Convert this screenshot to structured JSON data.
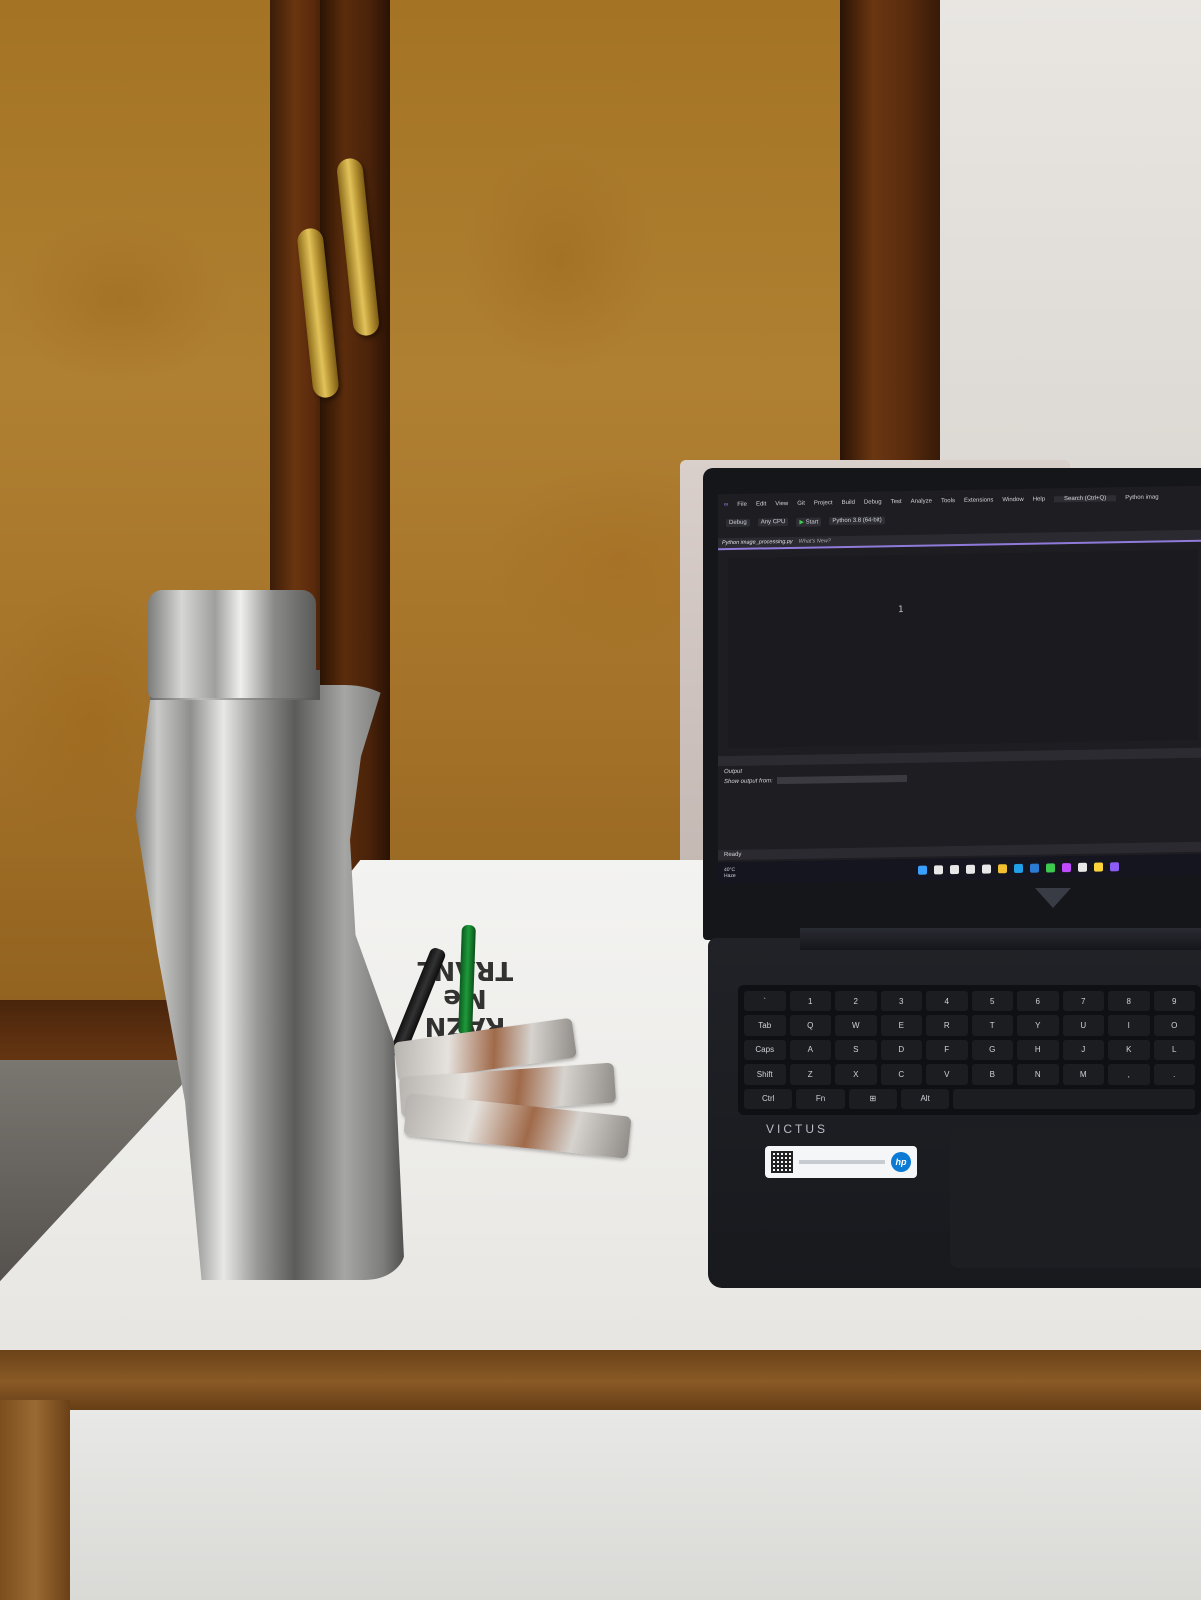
{
  "scene": {
    "objects": [
      "steel-bottle",
      "laptop",
      "green-pen",
      "black-pen",
      "medicine-strips",
      "wardrobe",
      "desk"
    ]
  },
  "marker_writing": {
    "line1": "RAZN",
    "line2": "Me",
    "line3": "TRANL"
  },
  "laptop": {
    "brand": "VICTUS",
    "sticker_logo": "hp",
    "ide": {
      "menu": [
        "File",
        "Edit",
        "View",
        "Git",
        "Project",
        "Build",
        "Debug",
        "Test",
        "Analyze",
        "Tools",
        "Extensions",
        "Window",
        "Help"
      ],
      "search_placeholder": "Search (Ctrl+Q)",
      "window_title": "Python imag",
      "toolbar": {
        "config": "Debug",
        "platform": "Any CPU",
        "start": "Start",
        "interpreter": "Python 3.8 (64-bit)"
      },
      "tabs": {
        "active": "Python image_processing.py",
        "whats_new": "What's New?"
      },
      "editor": {
        "line_number": "1"
      },
      "output": {
        "title": "Output",
        "show_from": "Show output from:"
      },
      "status": "Ready",
      "weather": {
        "temp": "40°C",
        "desc": "Haze"
      },
      "taskbar_icons": [
        "windows",
        "search",
        "task-view",
        "widgets",
        "chat",
        "explorer",
        "edge",
        "store",
        "chrome",
        "vs",
        "onenote",
        "paint",
        "discord"
      ],
      "taskbar_colors": [
        "#3aa0ff",
        "#e8e8e8",
        "#e8e8e8",
        "#e8e8e8",
        "#e8e8e8",
        "#f0c030",
        "#1fa0e8",
        "#2b7cd3",
        "#3ec94f",
        "#c04aff",
        "#e8e8e8",
        "#ffd43b",
        "#8b5cf6"
      ]
    }
  },
  "colors": {
    "wood": "#a47424",
    "desk": "#f0efec",
    "laptop_body": "#18191d",
    "ide_accent": "#8f7ad9"
  }
}
